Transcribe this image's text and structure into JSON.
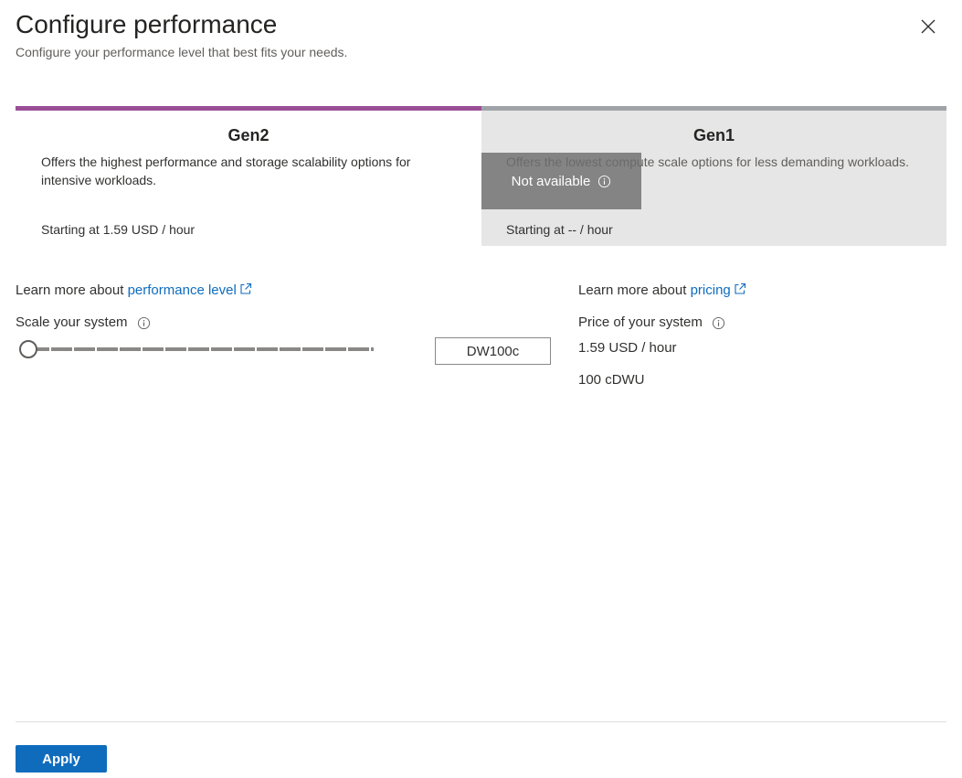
{
  "header": {
    "title": "Configure performance",
    "subtitle": "Configure your performance level that best fits your needs."
  },
  "tiers": [
    {
      "name": "Gen2",
      "description": "Offers the highest performance and storage scalability options for intensive workloads.",
      "price": "Starting at 1.59 USD / hour",
      "accent_color": "#9b4f96"
    },
    {
      "name": "Gen1",
      "description": "Offers the lowest compute scale options for less demanding workloads.",
      "price": "Starting at -- / hour",
      "overlay": "Not available",
      "accent_color": "#a0a4a8"
    }
  ],
  "learn_more": {
    "performance_prefix": "Learn more about ",
    "performance_link": "performance level",
    "pricing_prefix": "Learn more about ",
    "pricing_link": "pricing"
  },
  "scale": {
    "label": "Scale your system",
    "value": "DW100c",
    "slider_fraction": 0
  },
  "price": {
    "label": "Price of your system",
    "hourly": "1.59 USD / hour",
    "units": "100 cDWU"
  },
  "footer": {
    "apply_label": "Apply"
  },
  "colors": {
    "link": "#0f6cbd",
    "primary_button": "#0f6cbd"
  },
  "icons": [
    "close-icon",
    "info-icon",
    "external-link-icon"
  ]
}
